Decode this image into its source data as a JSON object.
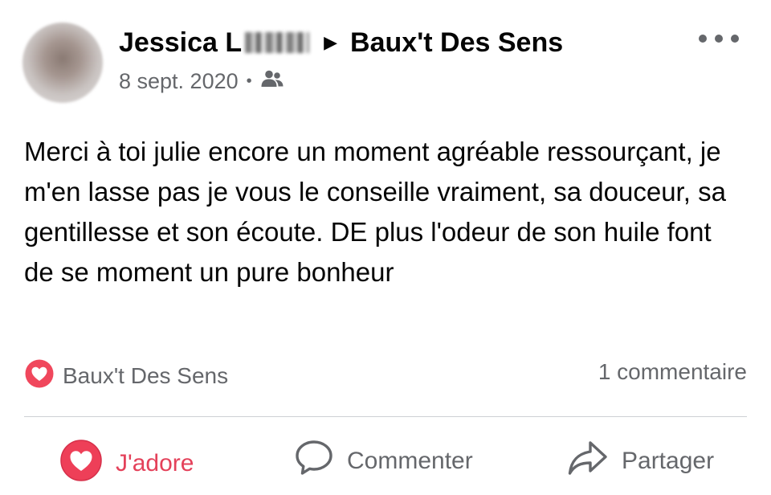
{
  "post": {
    "author": "Jessica L",
    "page_name": "Baux't Des Sens",
    "date": "8 sept. 2020",
    "audience_icon": "friends-icon",
    "more_icon": "more-dots-icon",
    "text": "Merci à toi julie encore un moment agréable ressourçant, je m'en lasse pas je vous le conseille vraiment, sa douceur, sa gentillesse et son écoute. DE plus l'odeur de son huile font de se moment un pure bonheur"
  },
  "reactions": {
    "icon": "love-reaction-icon",
    "label": "Baux't Des Sens",
    "comments": "1 commentaire"
  },
  "actions": {
    "adore": "J'adore",
    "comment": "Commenter",
    "share": "Partager"
  },
  "colors": {
    "love": "#e4415a",
    "muted_text": "#65676b",
    "divider": "#ced0d4"
  }
}
